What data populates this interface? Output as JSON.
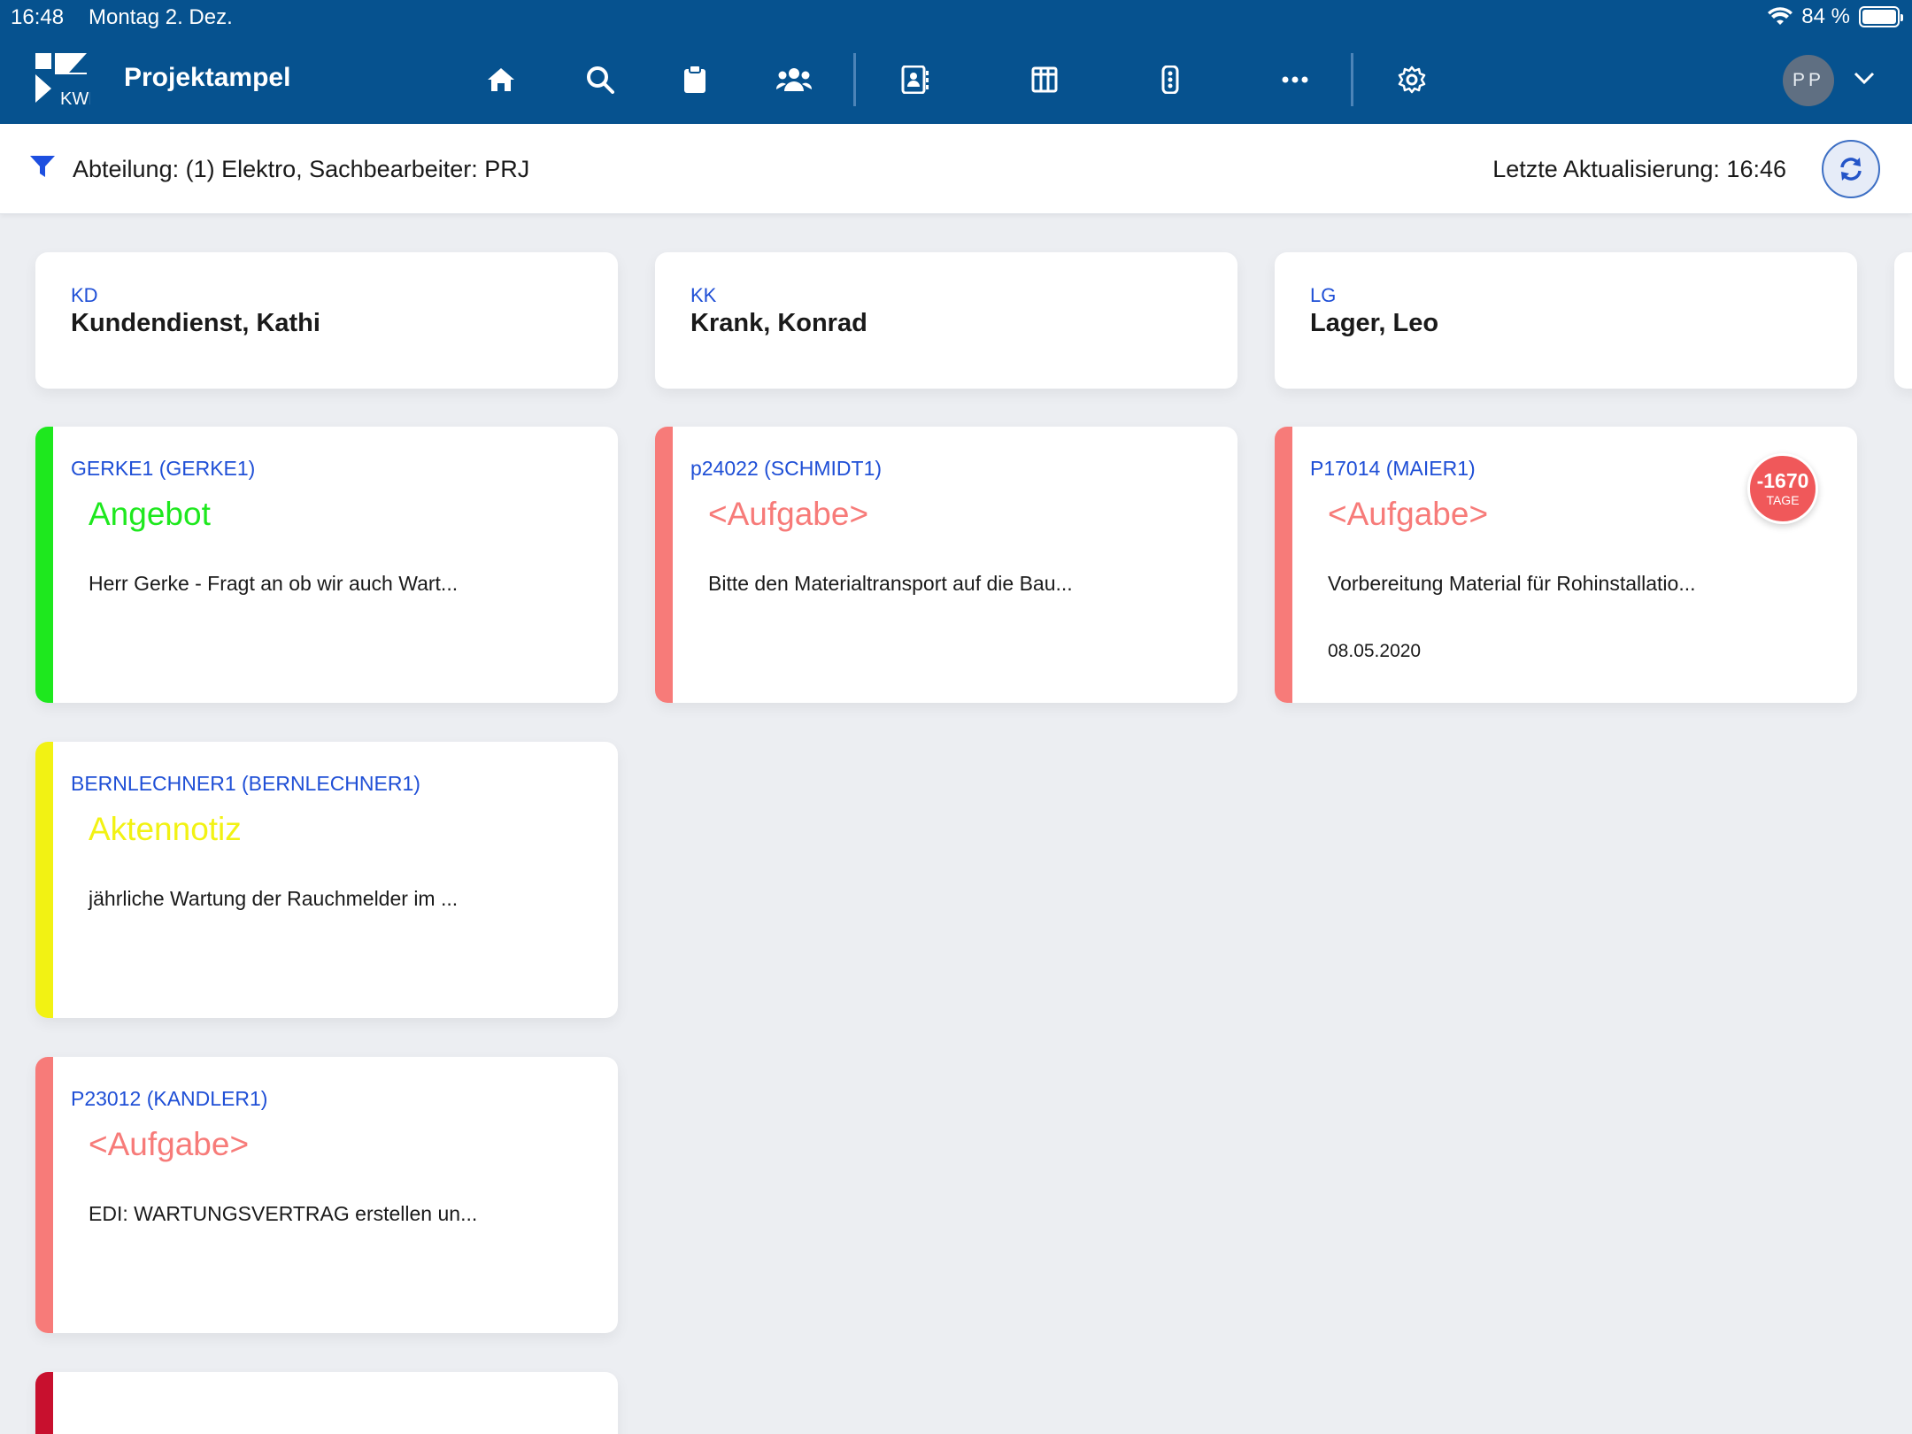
{
  "status": {
    "time": "16:48",
    "date": "Montag 2. Dez.",
    "battery": "84 %"
  },
  "app": {
    "title": "Projektampel",
    "logo_text": "KWP",
    "user_initials": "PP"
  },
  "nav": {
    "icons": [
      "home-icon",
      "search-icon",
      "clipboard-icon",
      "users-icon",
      "contacts-icon",
      "columns-icon",
      "traffic-light-icon",
      "more-icon",
      "gear-icon"
    ]
  },
  "filter": {
    "text": "Abteilung: (1) Elektro, Sachbearbeiter: PRJ",
    "last_update": "Letzte Aktualisierung: 16:46"
  },
  "columns": [
    {
      "code": "KD",
      "name": "Kundendienst, Kathi"
    },
    {
      "code": "KK",
      "name": "Krank, Konrad"
    },
    {
      "code": "LG",
      "name": "Lager, Leo"
    }
  ],
  "cards": [
    {
      "ref": "GERKE1 (GERKE1)",
      "type": "Angebot",
      "desc": "Herr Gerke - Fragt an ob wir auch Wart...",
      "color": "#1ee81e"
    },
    {
      "ref": "p24022 (SCHMIDT1)",
      "type": "<Aufgabe>",
      "desc": "Bitte den Materialtransport auf die Bau...",
      "color": "#f77b79"
    },
    {
      "ref": "P17014 (MAIER1)",
      "type": "<Aufgabe>",
      "desc": "Vorbereitung Material für Rohinstallatio...",
      "date": "08.05.2020",
      "badge_value": "-1670",
      "badge_unit": "TAGE",
      "color": "#f77b79"
    },
    {
      "ref": "BERNLECHNER1 (BERNLECHNER1)",
      "type": "Aktennotiz",
      "desc": "jährliche Wartung der Rauchmelder im ...",
      "color": "#f2f213"
    },
    {
      "ref": "P23012 (KANDLER1)",
      "type": "<Aufgabe>",
      "desc": "EDI:  WARTUNGSVERTRAG erstellen un...",
      "color": "#f77b79"
    },
    {
      "color": "#c8102e"
    }
  ]
}
